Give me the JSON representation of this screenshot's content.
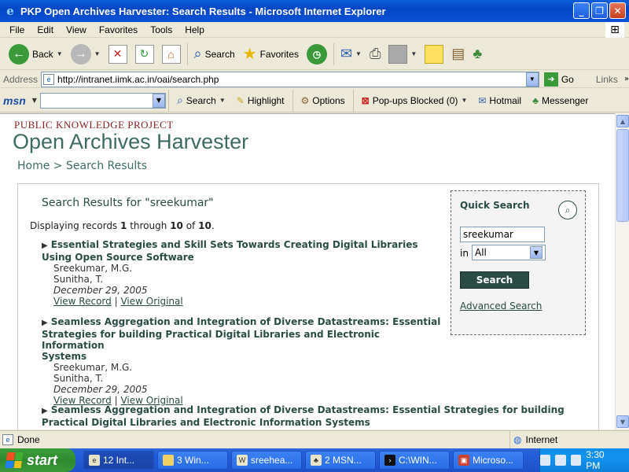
{
  "window": {
    "title": "PKP Open Archives Harvester: Search Results - Microsoft Internet Explorer",
    "minimize": "_",
    "maximize": "❐",
    "close": "✕"
  },
  "menu": [
    "File",
    "Edit",
    "View",
    "Favorites",
    "Tools",
    "Help"
  ],
  "toolbar": {
    "back": "Back",
    "search": "Search",
    "favorites": "Favorites"
  },
  "address": {
    "label": "Address",
    "url": "http://intranet.iimk.ac.in/oai/search.php",
    "go": "Go",
    "links": "Links"
  },
  "msnbar": {
    "logo": "msn",
    "search": "Search",
    "highlight": "Highlight",
    "options": "Options",
    "popups": "Pop-ups Blocked (0)",
    "hotmail": "Hotmail",
    "messenger": "Messenger"
  },
  "page": {
    "brand_top": "PUBLIC KNOWLEDGE PROJECT",
    "brand_main": "Open Archives Harvester",
    "breadcrumb_home": "Home",
    "breadcrumb_sep": ">",
    "breadcrumb_current": "Search Results",
    "results_title": "Search Results for \"sreekumar\"",
    "displaying_prefix": "Displaying records",
    "from": "1",
    "through_word": "through",
    "to": "10",
    "of_word": "of",
    "total": "10",
    "period": ".",
    "records": [
      {
        "title_1": "Essential Strategies and Skill Sets Towards Creating Digital Libraries",
        "title_2": "Using Open Source Software",
        "title_3": "",
        "author_1": "Sreekumar, M.G.",
        "author_2": "Sunitha, T.",
        "date": "December 29, 2005",
        "view_record": "View Record",
        "view_original": "View Original"
      },
      {
        "title_1": "Seamless Aggregation and Integration of Diverse Datastreams: Essential",
        "title_2": "Strategies for building Practical Digital Libraries and Electronic Information",
        "title_3": "Systems",
        "author_1": "Sreekumar, M.G.",
        "author_2": "Sunitha, T.",
        "date": "December 29, 2005",
        "view_record": "View Record",
        "view_original": "View Original"
      },
      {
        "title_1": "Seamless Aggregation and Integration of Diverse Datastreams: Essential Strategies for building",
        "title_2": "Practical Digital Libraries and Electronic Information Systems"
      }
    ],
    "links_sep": "|"
  },
  "quick_search": {
    "title": "Quick Search",
    "query": "sreekumar",
    "in_label": "in",
    "field": "All",
    "button": "Search",
    "advanced": "Advanced Search"
  },
  "status": {
    "text": "Done",
    "zone": "Internet"
  },
  "taskbar": {
    "start": "start",
    "tasks": [
      "12 Int...",
      "3 Win...",
      "sreehea...",
      "2 MSN...",
      "C:\\WIN...",
      "Microso..."
    ],
    "clock": "3:30 PM"
  },
  "colors": {
    "accent": "#2a4c45",
    "brand_red": "#8b2020",
    "xp_blue": "#0346c4"
  }
}
